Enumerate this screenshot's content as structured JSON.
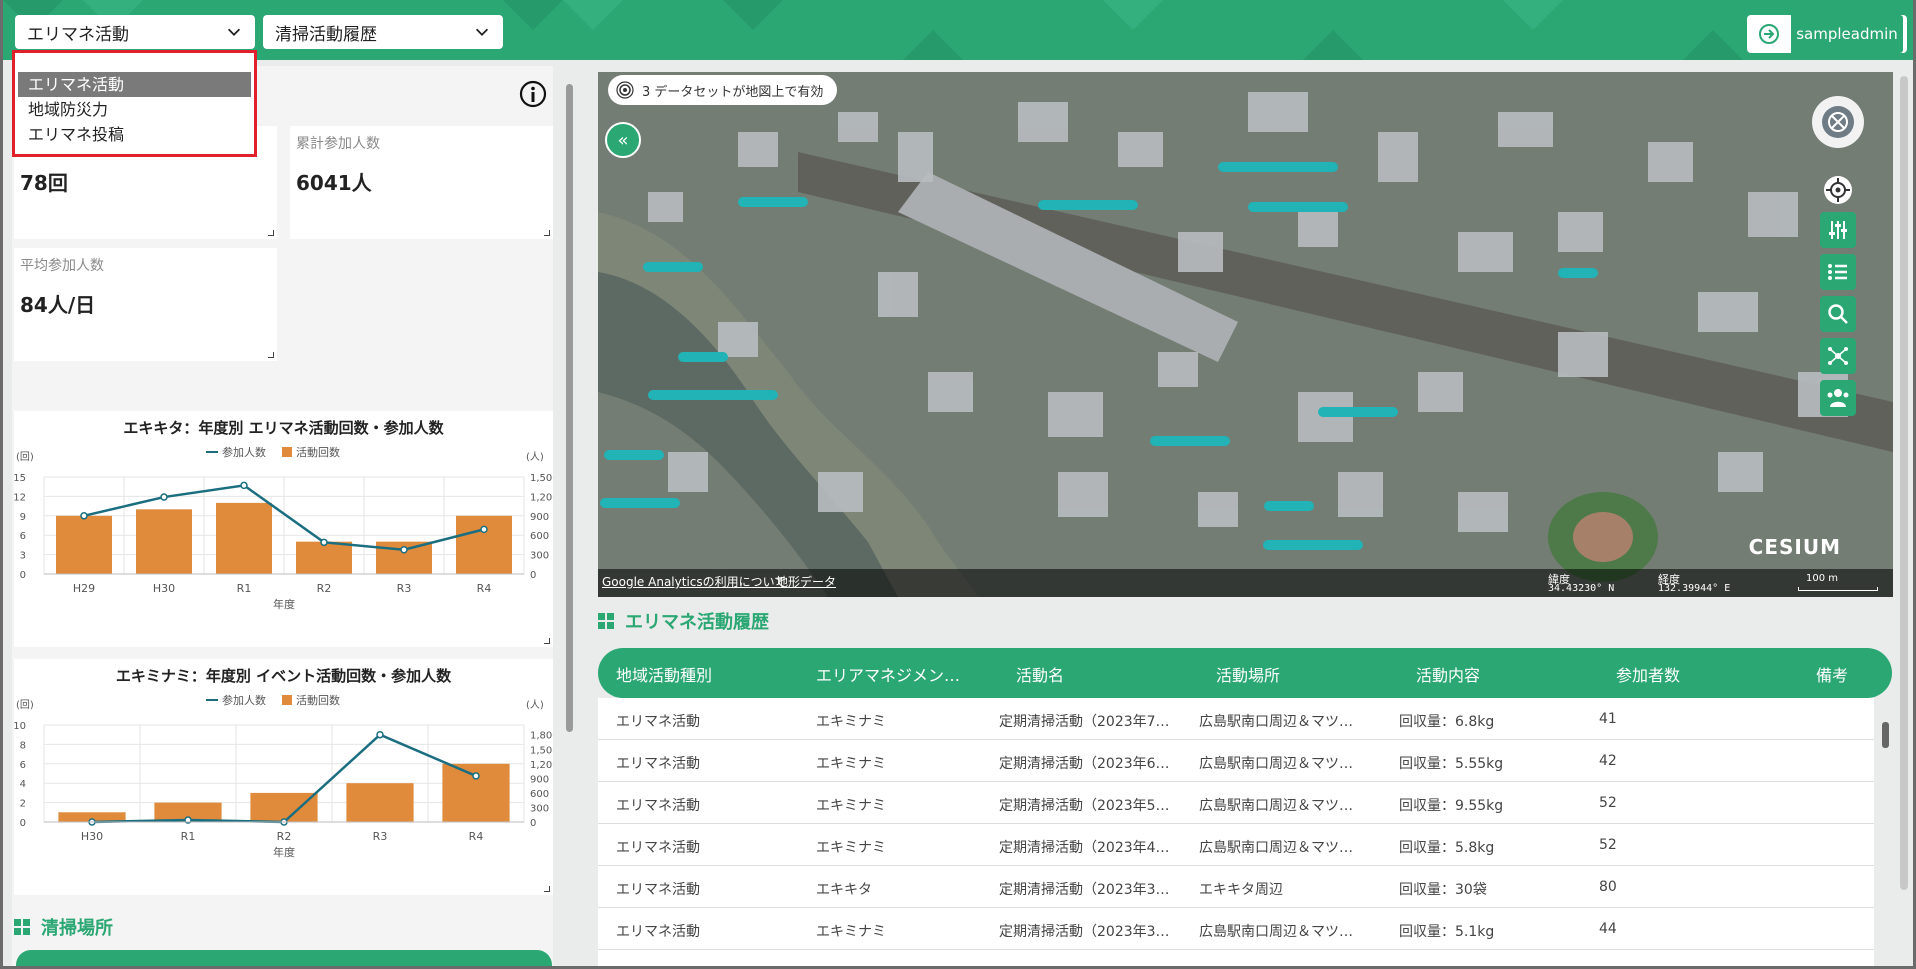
{
  "topbar": {
    "select1_value": "エリマネ活動",
    "select2_value": "清掃活動履歴",
    "user_name": "sampleadmin"
  },
  "dropdown": {
    "options": [
      "エリマネ活動",
      "地域防災力",
      "エリマネ投稿"
    ],
    "selected_index": 0
  },
  "stats": {
    "count_value": "78回",
    "total_label": "累計参加人数",
    "total_value": "6041人",
    "avg_label": "平均参加人数",
    "avg_value": "84人/日"
  },
  "charts": {
    "legend_line": "参加人数",
    "legend_bar": "活動回数",
    "left_unit": "(回)",
    "right_unit": "(人)",
    "xlabel": "年度"
  },
  "chart_data": [
    {
      "type": "bar",
      "title": "エキキタ：年度別 エリマネ活動回数・参加人数",
      "categories": [
        "H29",
        "H30",
        "R1",
        "R2",
        "R3",
        "R4"
      ],
      "xlabel": "年度",
      "y_left_label": "(回)",
      "y_right_label": "(人)",
      "y_left_ticks": [
        "0",
        "3",
        "6",
        "9",
        "12",
        "15"
      ],
      "y_right_ticks": [
        "0",
        "300",
        "600",
        "900",
        "1,200",
        "1,500"
      ],
      "ylim_left": [
        0,
        15
      ],
      "ylim_right": [
        0,
        1500
      ],
      "series": [
        {
          "name": "活動回数",
          "kind": "bar",
          "axis": "left",
          "values": [
            9,
            10,
            11,
            5,
            5,
            9
          ]
        },
        {
          "name": "参加人数",
          "kind": "line",
          "axis": "right",
          "values": [
            900,
            1190,
            1370,
            490,
            375,
            690
          ]
        }
      ],
      "bar_color": "#e08a3c",
      "line_color": "#1a6e80",
      "grid": true,
      "legend_position": "top"
    },
    {
      "type": "bar",
      "title": "エキミナミ：年度別 イベント活動回数・参加人数",
      "categories": [
        "H30",
        "R1",
        "R2",
        "R3",
        "R4"
      ],
      "xlabel": "年度",
      "y_left_label": "(回)",
      "y_right_label": "(人)",
      "y_left_ticks": [
        "0",
        "2",
        "4",
        "6",
        "8",
        "10"
      ],
      "y_right_ticks": [
        "0",
        "300",
        "600",
        "900",
        "1,200",
        "1,500",
        "1,800"
      ],
      "ylim_left": [
        0,
        10
      ],
      "ylim_right": [
        0,
        2000
      ],
      "series": [
        {
          "name": "活動回数",
          "kind": "bar",
          "axis": "left",
          "values": [
            1,
            2,
            3,
            4,
            6
          ]
        },
        {
          "name": "参加人数",
          "kind": "line",
          "axis": "right",
          "values": [
            0,
            40,
            0,
            1800,
            950
          ]
        }
      ],
      "bar_color": "#e08a3c",
      "line_color": "#1a6e80",
      "grid": true,
      "legend_position": "top"
    }
  ],
  "cleaning": {
    "title": "清掃場所"
  },
  "map": {
    "badge": "3 データセットが地図上で有効",
    "footer_link1": "Google Analyticsの利用について",
    "footer_link2": "地形データ",
    "lat_label": "緯度",
    "lat_value": "34.43230° N",
    "lon_label": "経度",
    "lon_value": "132.39944° E",
    "scale": "100 m",
    "brand": "CESIUM"
  },
  "history": {
    "title": "エリマネ活動履歴",
    "columns": [
      "地域活動種別",
      "エリアマネジメン…",
      "活動名",
      "活動場所",
      "活動内容",
      "参加者数",
      "備考"
    ],
    "rows": [
      [
        "エリマネ活動",
        "エキミナミ",
        "定期清掃活動（2023年7…",
        "広島駅南口周辺＆マツ…",
        "回収量：6.8kg",
        "41",
        ""
      ],
      [
        "エリマネ活動",
        "エキミナミ",
        "定期清掃活動（2023年6…",
        "広島駅南口周辺＆マツ…",
        "回収量：5.55kg",
        "42",
        ""
      ],
      [
        "エリマネ活動",
        "エキミナミ",
        "定期清掃活動（2023年5…",
        "広島駅南口周辺＆マツ…",
        "回収量：9.55kg",
        "52",
        ""
      ],
      [
        "エリマネ活動",
        "エキミナミ",
        "定期清掃活動（2023年4…",
        "広島駅南口周辺＆マツ…",
        "回収量：5.8kg",
        "52",
        ""
      ],
      [
        "エリマネ活動",
        "エキキタ",
        "定期清掃活動（2023年3…",
        "エキキタ周辺",
        "回収量：30袋",
        "80",
        ""
      ],
      [
        "エリマネ活動",
        "エキミナミ",
        "定期清掃活動（2023年3…",
        "広島駅南口周辺＆マツ…",
        "回収量：5.1kg",
        "44",
        ""
      ]
    ]
  }
}
